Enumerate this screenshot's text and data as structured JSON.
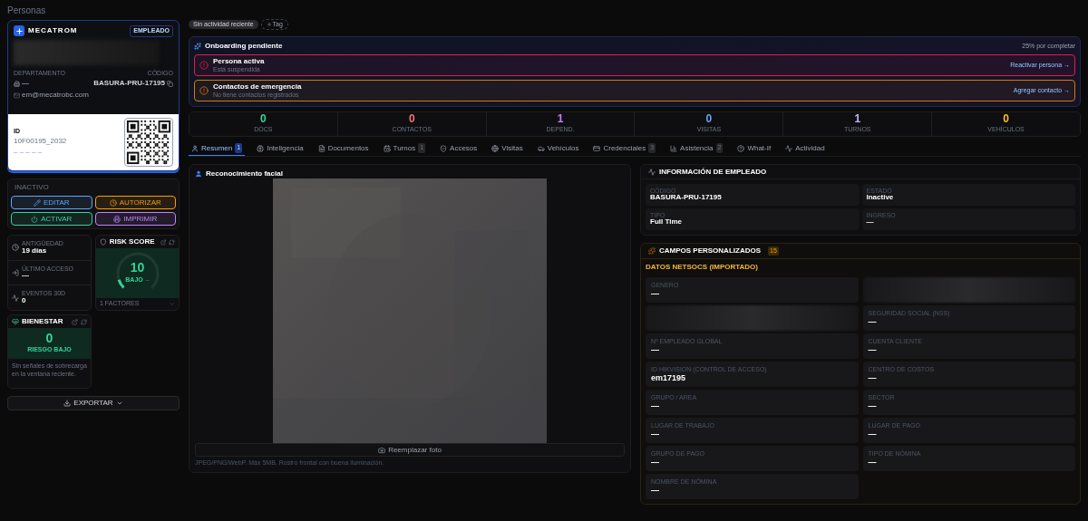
{
  "page": {
    "title": "Personas"
  },
  "id_card": {
    "brand": "MECATROM",
    "badge": "EMPLEADO",
    "department_label": "DEPARTAMENTO",
    "department": "—",
    "code_label": "CÓDIGO",
    "code": "BASURA-PRU-17195",
    "email": "em@mecatrobc.com",
    "id_label": "ID",
    "id_number": "10F00195_2032",
    "id_extra": "– – – – –"
  },
  "status": {
    "label": "INACTIVO"
  },
  "actions": [
    {
      "label": "EDITAR",
      "color": "#60a5fa"
    },
    {
      "label": "AUTORIZAR",
      "color": "#f59e0b"
    },
    {
      "label": "ACTIVAR",
      "color": "#34d399"
    },
    {
      "label": "IMPRIMIR",
      "color": "#c084fc"
    }
  ],
  "metrics": [
    {
      "label": "ANTIGÜEDAD",
      "value": "19 días"
    },
    {
      "label": "ÚLTIMO ACCESO",
      "value": "—"
    },
    {
      "label": "EVENTOS 30D",
      "value": "0"
    }
  ],
  "risk_score": {
    "title": "RISK SCORE",
    "score": "10",
    "level_text": "BAJO",
    "trend": "–",
    "level": 0.1,
    "factors": "1 FACTORES"
  },
  "wellbeing": {
    "title": "BIENESTAR",
    "score": "0",
    "risk": "RIESGO BAJO",
    "note": "Sin señales de sobrecarga en la ventana reciente."
  },
  "export_button": {
    "label": "EXPORTAR"
  },
  "chips": [
    {
      "label": "Sin actividad reciente",
      "kind": "status"
    },
    {
      "label": "Tag",
      "kind": "add"
    }
  ],
  "onboarding": {
    "title": "Onboarding pendiente",
    "progress": "25% por completar",
    "items": [
      {
        "title": "Persona activa",
        "subtitle": "Está suspendida",
        "action": "Reactivar persona →",
        "color": "#e11d48"
      },
      {
        "title": "Contactos de emergencia",
        "subtitle": "No tiene contactos registrados",
        "action": "Agregar contacto →",
        "color": "#d97706"
      }
    ]
  },
  "stats": [
    {
      "value": "0",
      "label": "DOCS",
      "color": "#34d399"
    },
    {
      "value": "0",
      "label": "CONTACTOS",
      "color": "#f87171"
    },
    {
      "value": "1",
      "label": "DEPEND.",
      "color": "#c084fc"
    },
    {
      "value": "0",
      "label": "VISITAS",
      "color": "#60a5fa"
    },
    {
      "value": "1",
      "label": "TURNOS",
      "color": "#c4b5fd"
    },
    {
      "value": "0",
      "label": "VEHÍCULOS",
      "color": "#fbbf24"
    }
  ],
  "tabs": [
    {
      "label": "Resumen",
      "count": "1",
      "selected": true,
      "kind": "user"
    },
    {
      "label": "Inteligencia",
      "selected": false,
      "kind": "brain"
    },
    {
      "label": "Documentos",
      "selected": false,
      "kind": "file"
    },
    {
      "label": "Turnos",
      "count": "1",
      "selected": false,
      "kind": "calendar"
    },
    {
      "label": "Accesos",
      "selected": false,
      "kind": "shield"
    },
    {
      "label": "Visitas",
      "selected": false,
      "kind": "globe"
    },
    {
      "label": "Vehículos",
      "selected": false,
      "kind": "car"
    },
    {
      "label": "Credenciales",
      "count": "3",
      "selected": false,
      "kind": "card"
    },
    {
      "label": "Asistencia",
      "count": "2",
      "selected": false,
      "kind": "chart"
    },
    {
      "label": "What-If",
      "selected": false,
      "kind": "help"
    },
    {
      "label": "Actividad",
      "selected": false,
      "kind": "activity"
    }
  ],
  "facial": {
    "title": "Reconocimiento facial",
    "button": "Reemplazar foto",
    "hint": "JPEG/PNG/WebP. Máx 5MB. Rostro frontal con buena iluminación."
  },
  "employee_info": {
    "title": "INFORMACIÓN DE EMPLEADO",
    "fields": [
      {
        "label": "CÓDIGO",
        "value": "BASURA-PRU-17195"
      },
      {
        "label": "ESTADO",
        "value": "Inactive"
      },
      {
        "label": "TIPO",
        "value": "Full Time"
      },
      {
        "label": "INGRESO",
        "value": "—"
      }
    ]
  },
  "custom_fields": {
    "title": "CAMPOS PERSONALIZADOS",
    "count": "15",
    "section": "DATOS NETSOCS (IMPORTADO)",
    "fields": [
      {
        "kind": "field",
        "label": "GENERO",
        "value": "—"
      },
      {
        "kind": "redacted"
      },
      {
        "kind": "redacted"
      },
      {
        "kind": "field",
        "label": "SEGURIDAD SOCIAL (NSS)",
        "value": "—"
      },
      {
        "kind": "field",
        "label": "Nº EMPLEADO GLOBAL",
        "value": "—"
      },
      {
        "kind": "field",
        "label": "CUENTA CLIENTE",
        "value": "—"
      },
      {
        "kind": "field",
        "label": "ID HIKVISION (CONTROL DE ACCESO)",
        "value": "em17195"
      },
      {
        "kind": "field",
        "label": "CENTRO DE COSTOS",
        "value": "—"
      },
      {
        "kind": "field",
        "label": "GRUPO / AREA",
        "value": "—"
      },
      {
        "kind": "field",
        "label": "SECTOR",
        "value": "—"
      },
      {
        "kind": "field",
        "label": "LUGAR DE TRABAJO",
        "value": "—"
      },
      {
        "kind": "field",
        "label": "LUGAR DE PAGO",
        "value": "—"
      },
      {
        "kind": "field",
        "label": "GRUPO DE PAGO",
        "value": "—"
      },
      {
        "kind": "field",
        "label": "TIPO DE NÓMINA",
        "value": "—"
      },
      {
        "kind": "field",
        "label": "NOMBRE DE NÓMINA",
        "value": "—"
      }
    ]
  }
}
